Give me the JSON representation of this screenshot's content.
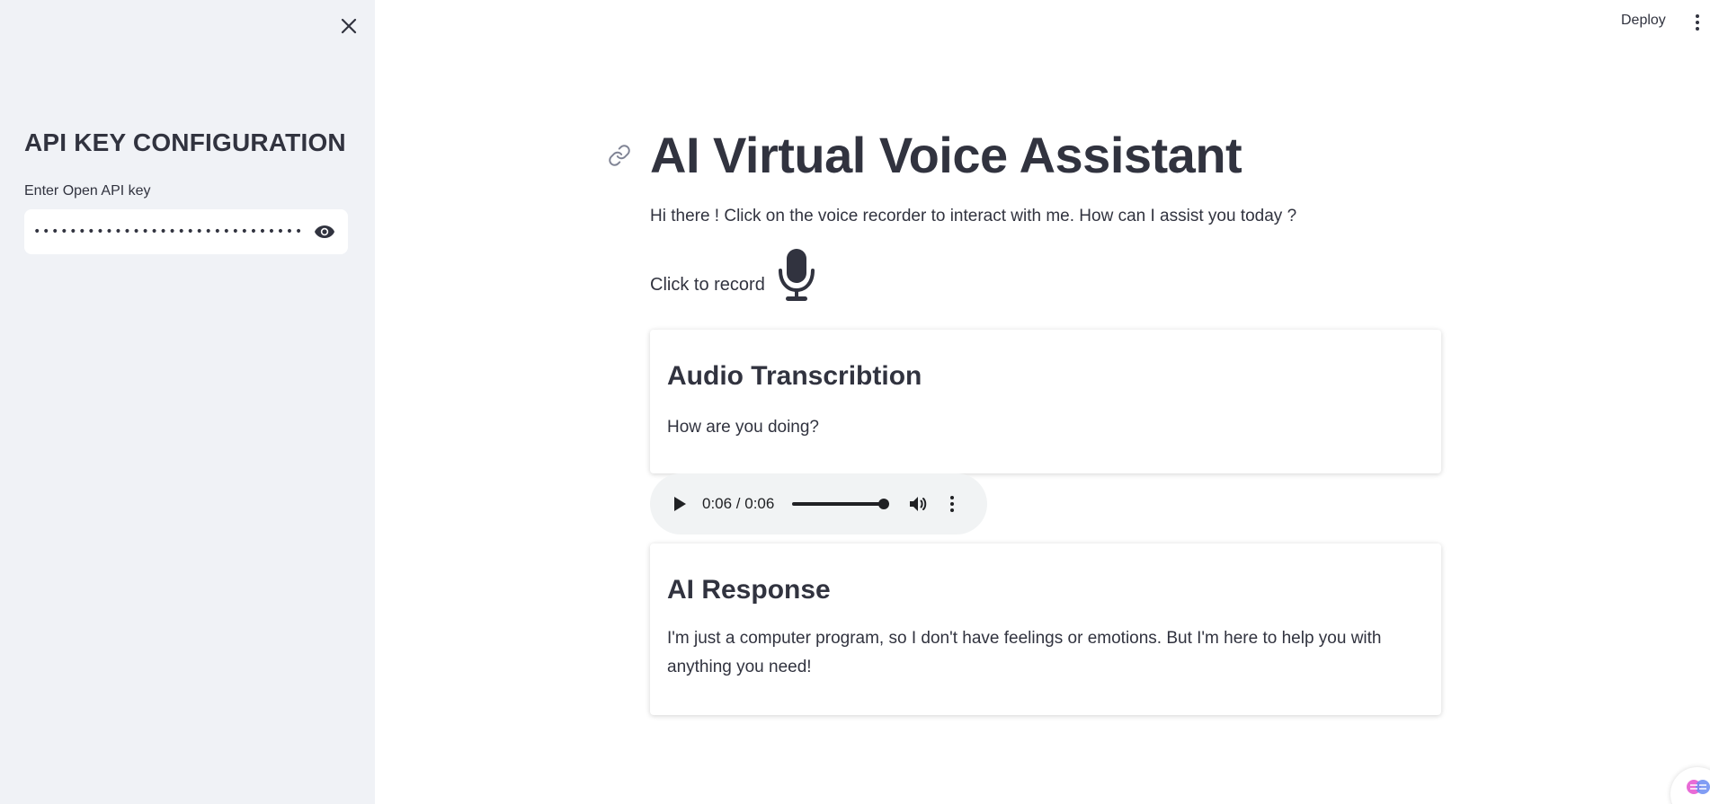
{
  "sidebar": {
    "title": "API KEY CONFIGURATION",
    "api_key_label": "Enter Open API key",
    "api_key_value": "••••••••••••••••••••••••••••••••••••••••••••••••••••••"
  },
  "header": {
    "deploy_label": "Deploy"
  },
  "main": {
    "title": "AI Virtual Voice Assistant",
    "intro": "Hi there ! Click on the voice recorder to interact with me. How can I assist you today ?",
    "record_label": "Click to record"
  },
  "transcription": {
    "title": "Audio Transcribtion",
    "text": "How are you doing?"
  },
  "audio_player": {
    "time": "0:06 / 0:06",
    "progress": 1.0
  },
  "ai_response": {
    "title": "AI Response",
    "text": "I'm just a computer program, so I don't have feelings or emotions. But I'm here to help you with anything you need!"
  },
  "colors": {
    "sidebar_bg": "#f0f2f6",
    "text": "#31333f",
    "player_bg": "#f1f3f4"
  },
  "icons": [
    "close-icon",
    "eye-icon",
    "kebab-menu-icon",
    "link-icon",
    "microphone-icon",
    "play-icon",
    "volume-icon",
    "more-options-icon",
    "app-badge-icon"
  ]
}
